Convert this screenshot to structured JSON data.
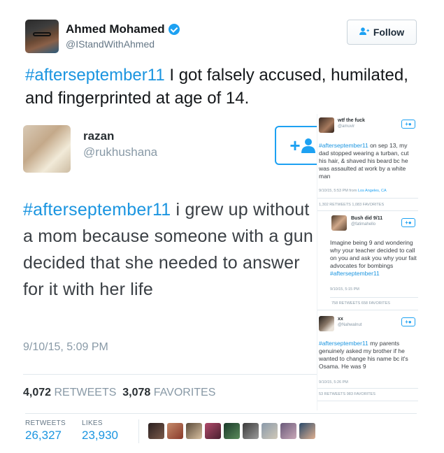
{
  "author": {
    "name": "Ahmed Mohamed",
    "handle": "@IStandWithAhmed",
    "verified": true,
    "follow_label": "Follow"
  },
  "tweet": {
    "hashtag": "#afterseptember11",
    "text": " I got falsely accused, humilated, and fingerprinted at age of 14."
  },
  "embedded": {
    "main": {
      "name": "razan",
      "handle": "@rukhushana",
      "hashtag": "#afterseptember11",
      "text": " i grew up without a mom because someone with a gun decided that she needed to answer for it with her life",
      "time": "9/10/15, 5:09 PM",
      "retweets": "4,072",
      "retweets_label": "RETWEETS",
      "favorites": "3,078",
      "favorites_label": "FAVORITES"
    },
    "side": [
      {
        "name": "wtf the fuck",
        "handle": "@amuvir",
        "hashtag": "#afterseptember11",
        "text": " on sep 13, my dad stopped wearing a turban, cut his hair, & shaved his beard bc he was assaulted at work by a white man",
        "time": "9/10/15, 5:53 PM from ",
        "location": "Los Angeles, CA",
        "stats": "1,302 RETWEETS   1,083 FAVORITES"
      },
      {
        "name": "Bush did 9/11",
        "handle": "@fatimahello",
        "hashtag": "#afterseptember11",
        "text": "Imagine being 9 and wondering why your teacher decided to call on you and ask you why your fait advocates for bombings ",
        "time": "9/10/15, 5:15 PM",
        "stats": "758 RETWEETS   658 FAVORITES"
      },
      {
        "name": "xx",
        "handle": "@Nahwalnut",
        "hashtag": "#afterseptember11",
        "text": " my parents genuinely asked my brother if he wanted to change his name bc it's Osama. He was 9",
        "time": "9/10/15, 5:26 PM",
        "stats": "53 RETWEETS   983 FAVORITES"
      }
    ]
  },
  "stats": {
    "retweets_label": "RETWEETS",
    "retweets": "26,327",
    "likes_label": "LIKES",
    "likes": "23,930"
  },
  "colors": {
    "link": "#1b95e0",
    "verified": "#1da1f2",
    "text": "#14171a",
    "muted": "#657786"
  },
  "icons": {
    "verified": "verified-badge-icon",
    "follow": "add-user-icon"
  }
}
